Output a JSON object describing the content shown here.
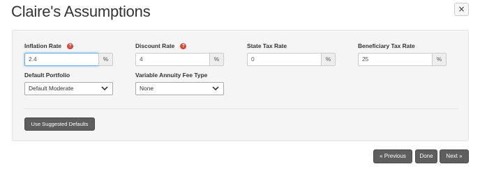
{
  "header": {
    "title": "Claire's Assumptions",
    "close_label": "×"
  },
  "fields": {
    "inflation": {
      "label": "Inflation Rate",
      "value": "2.4",
      "unit": "%",
      "help": "?"
    },
    "discount": {
      "label": "Discount Rate",
      "value": "4",
      "unit": "%",
      "help": "?"
    },
    "state_tax": {
      "label": "State Tax Rate",
      "value": "0",
      "unit": "%"
    },
    "beneficiary_tax": {
      "label": "Beneficiary Tax Rate",
      "value": "25",
      "unit": "%"
    },
    "default_portfolio": {
      "label": "Default Portfolio",
      "value": "Default Moderate"
    },
    "annuity_fee": {
      "label": "Variable Annuity Fee Type",
      "value": "None"
    }
  },
  "actions": {
    "use_defaults": "Use Suggested Defaults",
    "previous": "Previous",
    "done": "Done",
    "next": "Next"
  },
  "colors": {
    "button_bg": "#5e5e5e",
    "help_icon": "#d9453a",
    "focus": "#66afe9"
  }
}
